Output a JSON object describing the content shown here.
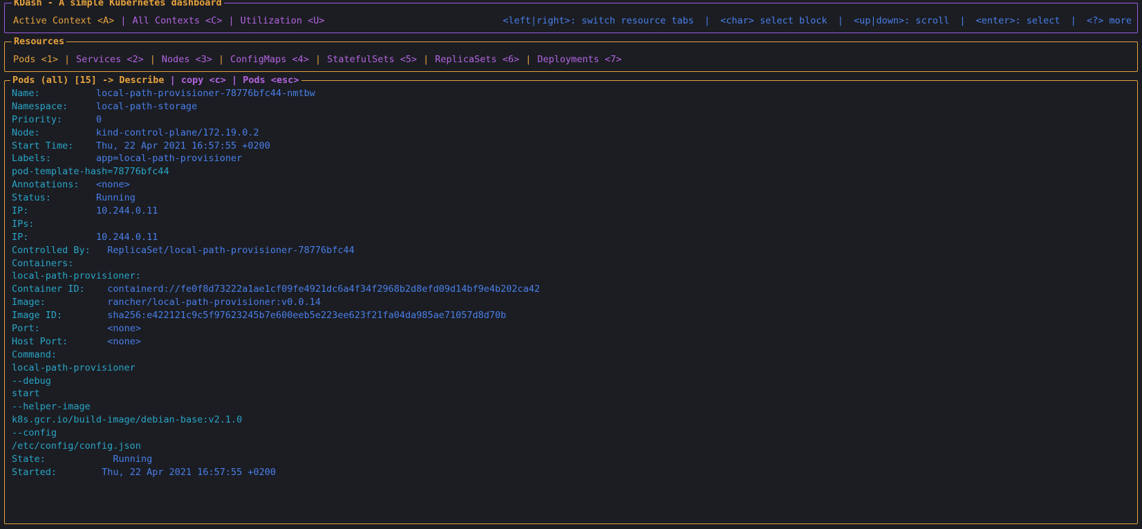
{
  "colors": {
    "background": "#1b1d23",
    "accent_orange": "#e8a33d",
    "accent_purple": "#b464e0",
    "key_teal": "#2aa5c7",
    "value_blue": "#4a7fe8"
  },
  "header": {
    "title": "KDash - A simple Kubernetes dashboard",
    "tabs": [
      {
        "label": "Active Context <A>",
        "active": true
      },
      {
        "label": "All Contexts <C>",
        "active": false
      },
      {
        "label": "Utilization <U>",
        "active": false
      }
    ],
    "hints": [
      "<left|right>: switch resource tabs",
      "<char> select block",
      "<up|down>: scroll",
      "<enter>: select",
      "<?> more"
    ]
  },
  "resources": {
    "title": "Resources",
    "tabs": [
      {
        "label": "Pods <1>",
        "active": true
      },
      {
        "label": "Services <2>",
        "active": false
      },
      {
        "label": "Nodes <3>",
        "active": false
      },
      {
        "label": "ConfigMaps <4>",
        "active": false
      },
      {
        "label": "StatefulSets <5>",
        "active": false
      },
      {
        "label": "ReplicaSets <6>",
        "active": false
      },
      {
        "label": "Deployments <7>",
        "active": false
      }
    ]
  },
  "describe": {
    "title_parts": [
      {
        "text": "Pods (all) [15] -> Describe",
        "color": "orange"
      },
      {
        "text": " | ",
        "color": "purple"
      },
      {
        "text": "copy <c>",
        "color": "purple"
      },
      {
        "text": " | ",
        "color": "purple"
      },
      {
        "text": "Pods <esc>",
        "color": "purple"
      }
    ],
    "resource_name": "Pods (all)",
    "resource_count": "[15]",
    "view": "Describe",
    "copy_hint": "copy <c>",
    "back_hint": "Pods <esc>",
    "lines": [
      {
        "key": "Name:",
        "pad": 9,
        "value": "local-path-provisioner-78776bfc44-nmtbw"
      },
      {
        "key": "Namespace:",
        "pad": 4,
        "value": "local-path-storage"
      },
      {
        "key": "Priority:",
        "pad": 5,
        "value": "0"
      },
      {
        "key": "Node:",
        "pad": 9,
        "value": "kind-control-plane/172.19.0.2"
      },
      {
        "key": "Start Time:",
        "pad": 3,
        "value": "Thu, 22 Apr 2021 16:57:55 +0200"
      },
      {
        "key": "Labels:",
        "pad": 7,
        "value": "app=local-path-provisioner"
      },
      {
        "key": "pod-template-hash=78776bfc44",
        "pad": 0,
        "value": ""
      },
      {
        "key": "Annotations:",
        "pad": 2,
        "value": "<none>"
      },
      {
        "key": "Status:",
        "pad": 7,
        "value": "Running"
      },
      {
        "key": "IP:",
        "pad": 11,
        "value": "10.244.0.11"
      },
      {
        "key": "IPs:",
        "pad": 0,
        "value": ""
      },
      {
        "key": "IP:",
        "pad": 11,
        "value": "10.244.0.11"
      },
      {
        "key": "Controlled By:",
        "pad": 2,
        "value": "ReplicaSet/local-path-provisioner-78776bfc44"
      },
      {
        "key": "Containers:",
        "pad": 0,
        "value": ""
      },
      {
        "key": "local-path-provisioner:",
        "pad": 0,
        "value": ""
      },
      {
        "key": "Container ID:",
        "pad": 3,
        "value": "containerd://fe0f8d73222a1ae1cf09fe4921dc6a4f34f2968b2d8efd09d14bf9e4b202ca42"
      },
      {
        "key": "Image:",
        "pad": 10,
        "value": "rancher/local-path-provisioner:v0.0.14"
      },
      {
        "key": "Image ID:",
        "pad": 7,
        "value": "sha256:e422121c9c5f97623245b7e600eeb5e223ee623f21fa04da985ae71057d8d70b"
      },
      {
        "key": "Port:",
        "pad": 11,
        "value": "<none>"
      },
      {
        "key": "Host Port:",
        "pad": 6,
        "value": "<none>"
      },
      {
        "key": "Command:",
        "pad": 0,
        "value": ""
      },
      {
        "key": "local-path-provisioner",
        "pad": 0,
        "value": ""
      },
      {
        "key": "--debug",
        "pad": 0,
        "value": ""
      },
      {
        "key": "start",
        "pad": 0,
        "value": ""
      },
      {
        "key": "--helper-image",
        "pad": 0,
        "value": ""
      },
      {
        "key": "k8s.gcr.io/build-image/debian-base:v2.1.0",
        "pad": 0,
        "value": ""
      },
      {
        "key": "--config",
        "pad": 0,
        "value": ""
      },
      {
        "key": "/etc/config/config.json",
        "pad": 0,
        "value": ""
      },
      {
        "key": "State:",
        "pad": 11,
        "value": "Running"
      },
      {
        "key": "Started:",
        "pad": 7,
        "value": "Thu, 22 Apr 2021 16:57:55 +0200"
      }
    ]
  }
}
